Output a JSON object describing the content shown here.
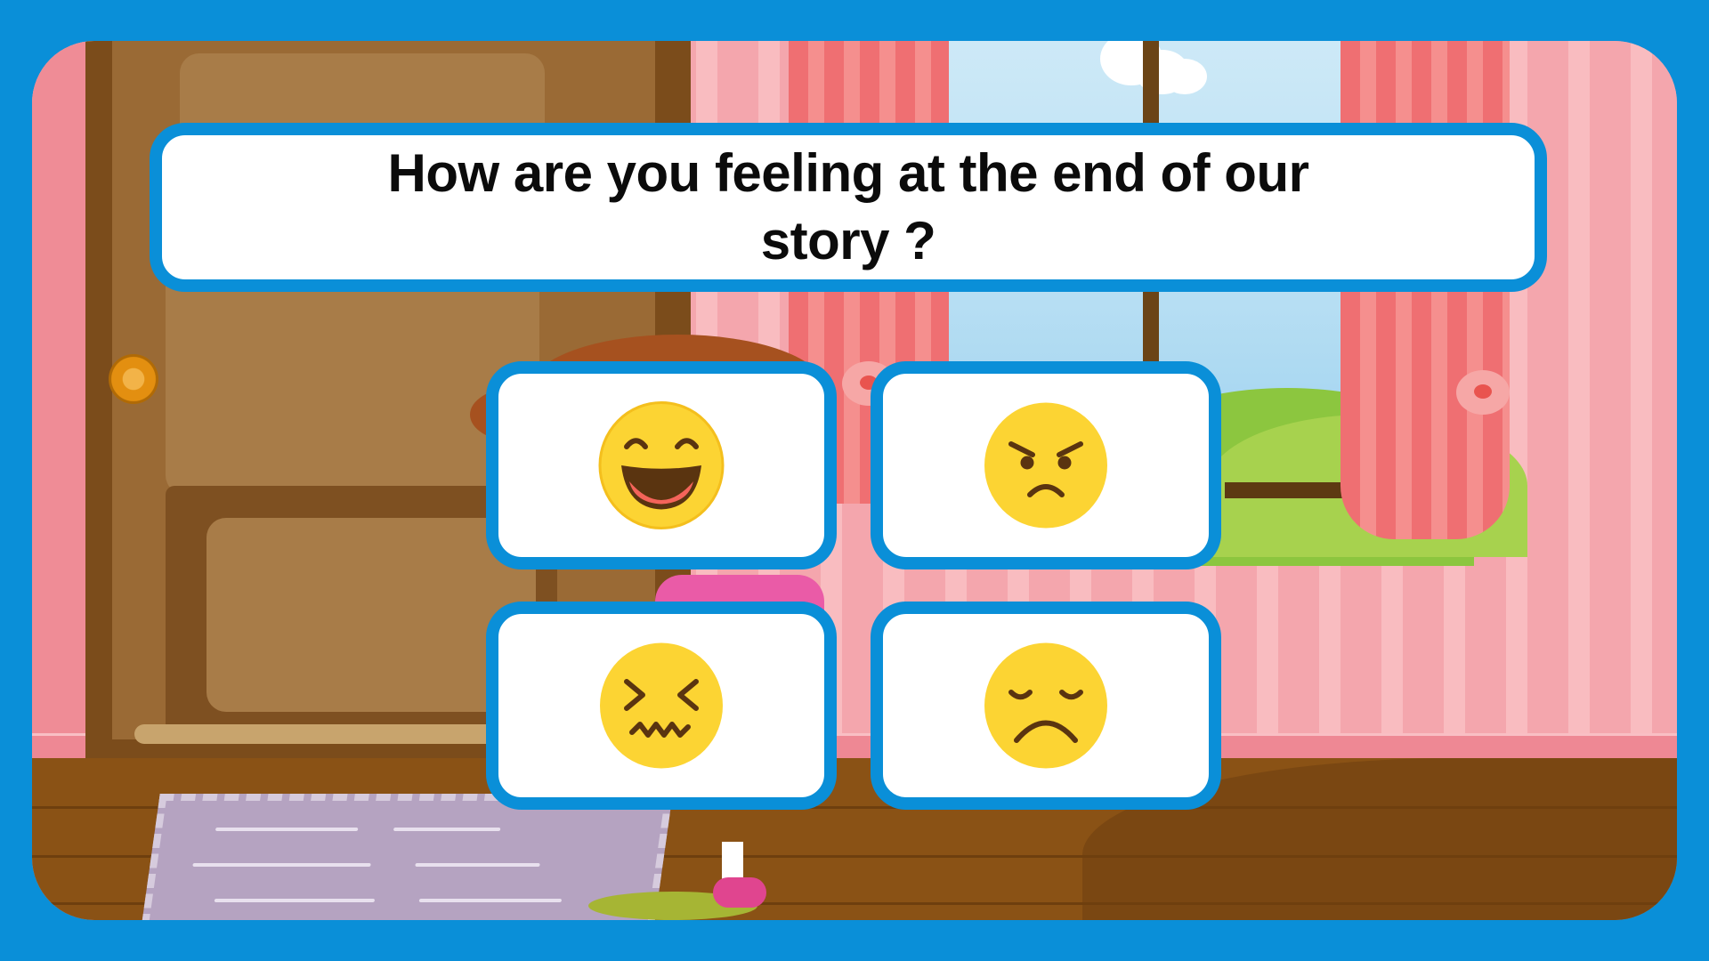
{
  "question": {
    "text": "How are you feeling at the end of our story ?"
  },
  "answers": [
    {
      "icon": "happy-face-icon"
    },
    {
      "icon": "angry-face-icon"
    },
    {
      "icon": "confounded-face-icon"
    },
    {
      "icon": "sad-face-icon"
    }
  ],
  "colors": {
    "frame": "#0a8fd8",
    "emoji": "#fcd433",
    "wall": "#f4a6ad",
    "floor": "#8a5215"
  }
}
